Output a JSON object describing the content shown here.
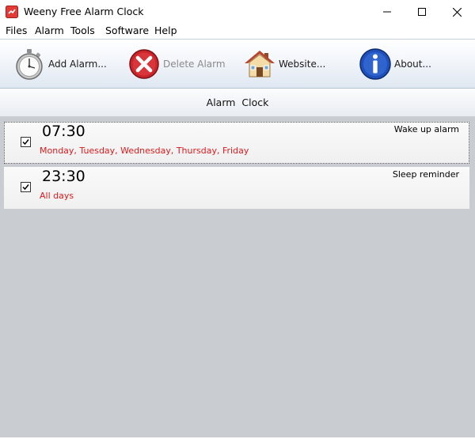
{
  "window": {
    "title": "Weeny Free Alarm Clock",
    "controls": [
      "minimize-icon",
      "maximize-icon",
      "close-icon"
    ]
  },
  "menu": {
    "items": [
      "Files",
      "Alarm",
      "Tools",
      "Software",
      "Help"
    ]
  },
  "toolbar": {
    "add_label": "Add Alarm...",
    "delete_label": "Delete Alarm",
    "website_label": "Website...",
    "about_label": "About...",
    "icons": [
      "stopwatch-icon",
      "delete-icon",
      "house-icon",
      "info-icon"
    ],
    "delete_enabled": false
  },
  "header": {
    "title": "Alarm  Clock"
  },
  "alarms": [
    {
      "time": "07:30",
      "days": "Monday, Tuesday, Wednesday, Thursday, Friday",
      "name": "Wake up alarm",
      "checked": true,
      "selected": true
    },
    {
      "time": "23:30",
      "days": "All days",
      "name": "Sleep reminder",
      "checked": true,
      "selected": false
    }
  ],
  "colors": {
    "days_text": "#e0191b",
    "list_background": "#c9ccd1",
    "toolbar_gradient_bottom": "#dfe7f1"
  }
}
